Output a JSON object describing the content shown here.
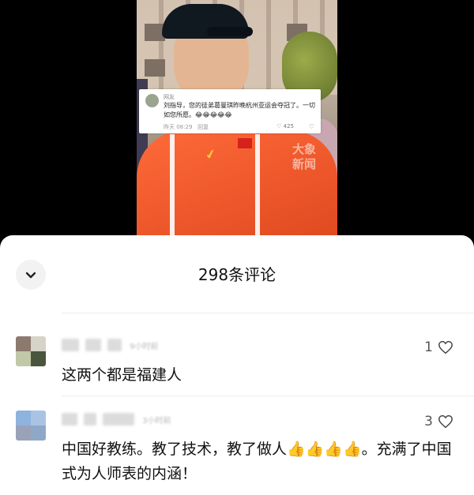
{
  "video": {
    "watermark": "大象\n新闻",
    "overlay_comment": {
      "username": "网友",
      "text": "刘指导，您的徒弟葛曼琪昨晚杭州亚运会夺冠了。一切如您所愿。😂😂😂😂😂",
      "time": "昨天 08:29",
      "reply_label": "回复",
      "likes": "425"
    }
  },
  "sheet": {
    "title": "298条评论",
    "comments": [
      {
        "time_hint": "9小时前",
        "text": "这两个都是福建人",
        "likes": "1"
      },
      {
        "time_hint": "3小时前",
        "text": "中国好教练。教了技术，教了做人👍👍👍👍。充满了中国式为人师表的内涵！",
        "likes": "3"
      }
    ]
  },
  "colors": {
    "sheet_bg": "#ffffff",
    "jacket": "#e9542a",
    "text": "#111111"
  },
  "icons": {
    "close": "chevron-down-icon",
    "like": "heart-outline-icon"
  }
}
